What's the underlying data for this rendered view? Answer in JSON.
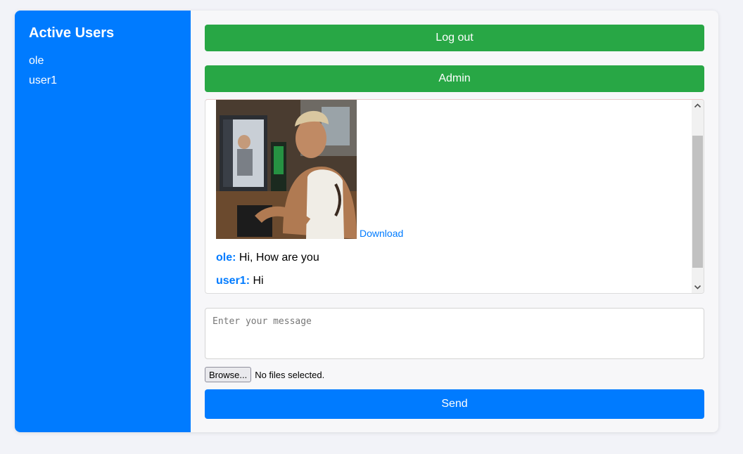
{
  "sidebar": {
    "title": "Active Users",
    "users": [
      "ole",
      "user1"
    ]
  },
  "header": {
    "logout_label": "Log out",
    "admin_label": "Admin"
  },
  "chat": {
    "download_label": "Download",
    "messages": [
      {
        "author": "ole:",
        "text": "Hi, How are you"
      },
      {
        "author": "user1:",
        "text": "Hi"
      }
    ]
  },
  "composer": {
    "placeholder": "Enter your message",
    "browse_label": "Browse...",
    "file_status": "No files selected.",
    "send_label": "Send"
  },
  "colors": {
    "primary": "#007bff",
    "success": "#28a745"
  },
  "icons": {
    "scroll_up": "chevron-up-icon",
    "scroll_down": "chevron-down-icon"
  }
}
